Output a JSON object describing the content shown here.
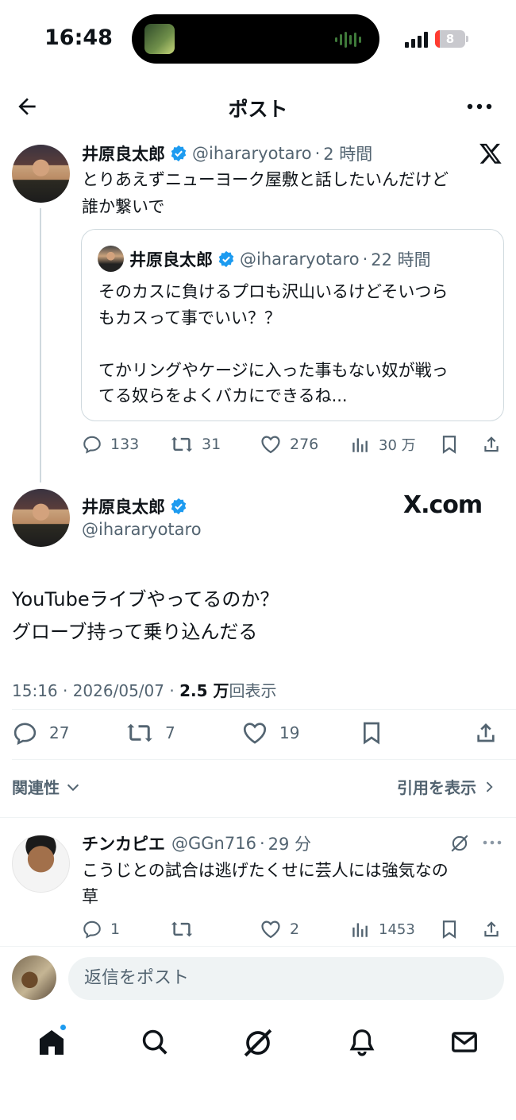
{
  "status_bar": {
    "time": "16:48",
    "battery": "8"
  },
  "header": {
    "title": "ポスト"
  },
  "parent_post": {
    "name": "井原良太郎",
    "handle": "@ihararyotaro",
    "time": "2 時間",
    "text_line1": "とりあえずニューヨーク屋敷と話したいんだけど",
    "text_line2": "誰か繋いで",
    "quote": {
      "name": "井原良太郎",
      "handle": "@ihararyotaro",
      "time": "22 時間",
      "line1": "そのカスに負けるプロも沢山いるけどそいつら",
      "line2": "もカスって事でいい？？",
      "line3": "てかリングやケージに入った事もない奴が戦っ",
      "line4": "てる奴らをよくバカにできるね..."
    },
    "metrics": {
      "replies": "133",
      "reposts": "31",
      "likes": "276",
      "views": "30 万"
    }
  },
  "main_post": {
    "name": "井原良太郎",
    "handle": "@ihararyotaro",
    "watermark": "X.com",
    "text_line1": "YouTubeライブやってるのか？",
    "text_line2": "グローブ持って乗り込んだる",
    "timestamp": "15:16 · 2026/05/07 · ",
    "views_count": "2.5 万",
    "views_label": "回表示",
    "metrics": {
      "replies": "27",
      "reposts": "7",
      "likes": "19"
    }
  },
  "sort": {
    "label": "関連性",
    "quotes_link": "引用を表示"
  },
  "reply": {
    "name": "チンカピエ",
    "handle": "@GGn716",
    "time": "29 分",
    "text_line1": "こうじとの試合は逃げたくせに芸人には強気なの",
    "text_line2": "草",
    "metrics": {
      "replies": "1",
      "reposts": "",
      "likes": "2",
      "views": "1453"
    }
  },
  "compose": {
    "placeholder": "返信をポスト"
  },
  "colors": {
    "verified": "#1d9bf0",
    "text": "#0f1419",
    "secondary": "#536471",
    "notification_dot": "#1d9bf0"
  }
}
